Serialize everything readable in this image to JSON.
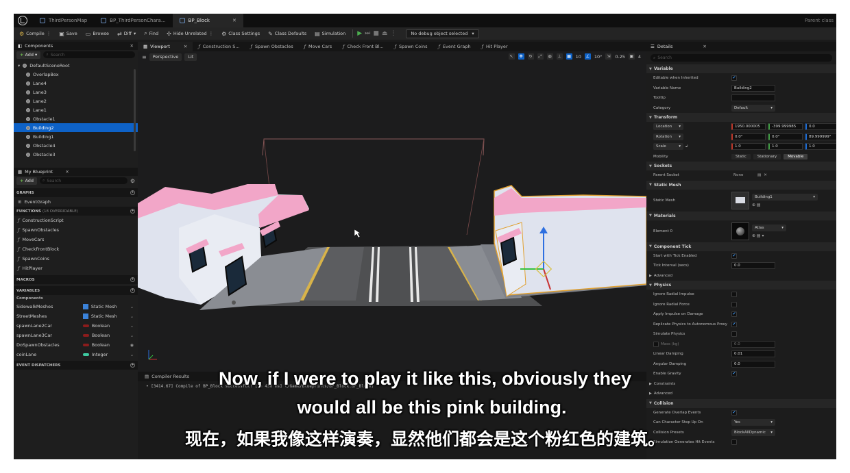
{
  "file_tabs": [
    {
      "label": "ThirdPersonMap"
    },
    {
      "label": "BP_ThirdPersonChara..."
    },
    {
      "label": "BP_Block",
      "active": true
    }
  ],
  "parent_class_label": "Parent class",
  "toolbar": {
    "compile": "Compile",
    "save": "Save",
    "browse": "Browse",
    "diff": "Diff",
    "find": "Find",
    "hide_unrelated": "Hide Unrelated",
    "class_settings": "Class Settings",
    "class_defaults": "Class Defaults",
    "simulation": "Simulation",
    "debug_object": "No debug object selected"
  },
  "components": {
    "title": "Components",
    "add": "Add",
    "search_placeholder": "Search",
    "items": [
      {
        "label": "DefaultSceneRoot",
        "level": 0
      },
      {
        "label": "OverlapBox",
        "level": 1
      },
      {
        "label": "Lane4",
        "level": 1
      },
      {
        "label": "Lane3",
        "level": 1
      },
      {
        "label": "Lane2",
        "level": 1
      },
      {
        "label": "Lane1",
        "level": 1
      },
      {
        "label": "Obstacle1",
        "level": 1
      },
      {
        "label": "Building2",
        "level": 1,
        "selected": true
      },
      {
        "label": "Building1",
        "level": 1
      },
      {
        "label": "Obstacle4",
        "level": 1
      },
      {
        "label": "Obstacle3",
        "level": 1
      }
    ]
  },
  "my_blueprint": {
    "title": "My Blueprint",
    "add": "Add",
    "search_placeholder": "Search",
    "graphs_header": "GRAPHS",
    "graphs": [
      "EventGraph"
    ],
    "functions_header": "FUNCTIONS",
    "functions_count": "(18 OVERRIDABLE)",
    "functions": [
      "ConstructionScript",
      "SpawnObstacles",
      "MoveCars",
      "CheckFrontBlock",
      "SpawnCoins",
      "HitPlayer"
    ],
    "macros_header": "MACROS",
    "variables_header": "VARIABLES",
    "variables_group": "Components",
    "variables": [
      {
        "name": "SidewalkMeshes",
        "type": "Static Mesh",
        "color": "#3b82d9"
      },
      {
        "name": "StreetMeshes",
        "type": "Static Mesh",
        "color": "#3b82d9"
      },
      {
        "name": "spawnLane2Car",
        "type": "Boolean",
        "color": "#8b1c1c"
      },
      {
        "name": "spawnLane3Car",
        "type": "Boolean",
        "color": "#8b1c1c"
      },
      {
        "name": "DoSpawnObstacles",
        "type": "Boolean",
        "color": "#8b1c1c"
      },
      {
        "name": "coinLane",
        "type": "Integer",
        "color": "#3ec9a0"
      }
    ],
    "dispatchers_header": "EVENT DISPATCHERS"
  },
  "editor_tabs": [
    "Viewport",
    "Construction S...",
    "Spawn Obstacles",
    "Move Cars",
    "Check Front Bl...",
    "Spawn Coins",
    "Event Graph",
    "Hit Player"
  ],
  "viewport": {
    "perspective": "Perspective",
    "lit": "Lit",
    "grid_snap": "10",
    "rot_snap": "10°",
    "scale_snap": "0.25",
    "cam_speed": "4"
  },
  "compiler": {
    "tab1": "Compiler Results",
    "log": "• [3414.67] Compile of BP_Block successful! [in 430 ms] (/Game/Blueprints/BP_Block.BP_Block)"
  },
  "details": {
    "title": "Details",
    "search_placeholder": "Search",
    "variable": {
      "header": "Variable",
      "editable_label": "Editable when Inherited",
      "name_label": "Variable Name",
      "name_value": "Building2",
      "tooltip_label": "Tooltip",
      "category_label": "Category",
      "category_value": "Default"
    },
    "transform": {
      "header": "Transform",
      "location_label": "Location",
      "location": [
        "1950.000005",
        "-399.999985",
        "0.0"
      ],
      "rotation_label": "Rotation",
      "rotation": [
        "0.0°",
        "0.0°",
        "89.999999°"
      ],
      "scale_label": "Scale",
      "scale": [
        "1.0",
        "1.0",
        "1.0"
      ],
      "mobility_label": "Mobility",
      "mobility": [
        "Static",
        "Stationary",
        "Movable"
      ]
    },
    "sockets": {
      "header": "Sockets",
      "parent_label": "Parent Socket",
      "parent_value": "None"
    },
    "static_mesh": {
      "header": "Static Mesh",
      "label": "Static Mesh",
      "value": "Building1"
    },
    "materials": {
      "header": "Materials",
      "label": "Element 0",
      "value": "Atlas"
    },
    "tick": {
      "header": "Component Tick",
      "start_label": "Start with Tick Enabled",
      "interval_label": "Tick Interval (secs)",
      "interval_value": "0.0",
      "advanced": "Advanced"
    },
    "physics": {
      "header": "Physics",
      "rows": [
        "Ignore Radial Impulse",
        "Ignore Radial Force",
        "Apply Impulse on Damage",
        "Replicate Physics to Autonomous Proxy",
        "Simulate Physics"
      ],
      "checks": [
        false,
        false,
        true,
        true,
        false
      ],
      "mass_label": "Mass (kg)",
      "mass_value": "0.0",
      "linear_label": "Linear Damping",
      "linear_value": "0.01",
      "angular_label": "Angular Damping",
      "angular_value": "0.0",
      "enable_gravity": "Enable Gravity",
      "constraints": "Constraints",
      "advanced": "Advanced"
    },
    "collision": {
      "header": "Collision",
      "overlap_label": "Generate Overlap Events",
      "can_step_label": "Can Character Step Up On",
      "can_step_value": "Yes",
      "presets_label": "Collision Presets",
      "presets_value": "BlockAllDynamic",
      "simulation_label": "Simulation Generates Hit Events"
    }
  },
  "subtitles": {
    "en_line1": "Now, if I were to play it like this, obviously they",
    "en_line2": "would all be this pink building.",
    "zh": "现在，如果我像这样演奏，显然他们都会是这个粉红色的建筑。"
  },
  "colors": {
    "selection": "#0e62c7",
    "building_pink": "#f2a6c8",
    "building_wall": "#dfe3ee",
    "road": "#5a5a5c",
    "lane_line": "#e8e8e8",
    "curb_yellow": "#d8b34a"
  }
}
